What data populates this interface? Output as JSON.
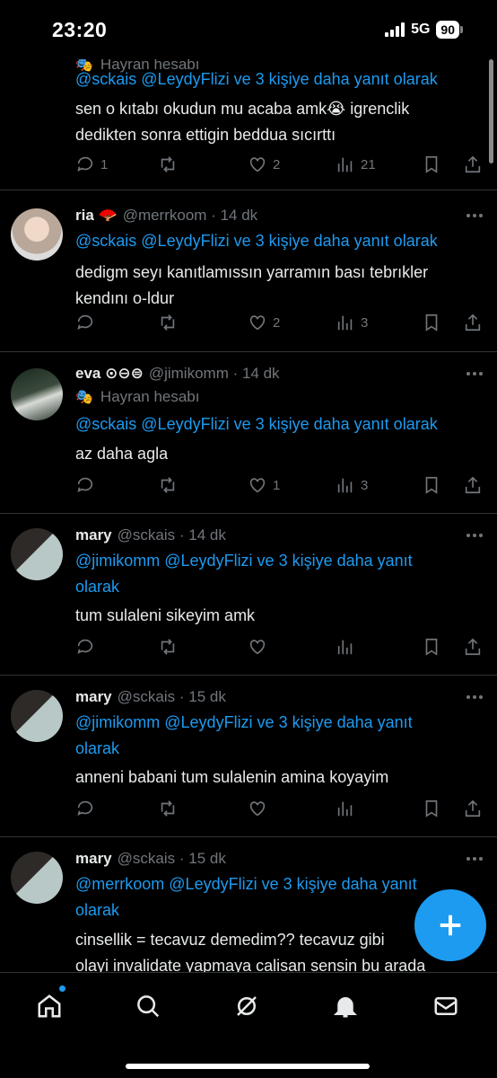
{
  "status": {
    "time": "23:20",
    "network": "5G",
    "battery": "90"
  },
  "posts": [
    {
      "label": "Hayran hesabı",
      "reply_to": "@sckais @LeydyFlizi ve 3 kişiye daha yanıt olarak",
      "text_lines": [
        "sen o kıtabı okudun mu acaba amk😭 igrenclik",
        "dedikten sonra ettigin beddua sıcırttı"
      ],
      "replies": "1",
      "retweets": "",
      "likes": "2",
      "views": "21"
    },
    {
      "author": "ria 🪭",
      "handle": "@merrkoom",
      "time": "14 dk",
      "reply_to": "@sckais @LeydyFlizi ve 3 kişiye daha yanıt olarak",
      "text_lines": [
        "dedigm seyı kanıtlamıssın yarramın bası tebrıkler",
        "kendını o-ldur"
      ],
      "replies": "",
      "retweets": "",
      "likes": "2",
      "views": "3"
    },
    {
      "author": "eva ⊙⊖⊜",
      "handle": "@jimikomm",
      "time": "14 dk",
      "label": "Hayran hesabı",
      "reply_to": "@sckais @LeydyFlizi ve 3 kişiye daha yanıt olarak",
      "text_lines": [
        "az daha agla"
      ],
      "replies": "",
      "retweets": "",
      "likes": "1",
      "views": "3"
    },
    {
      "author": "mary",
      "handle": "@sckais",
      "time": "14 dk",
      "reply_lines": [
        "@jimikomm @LeydyFlizi ve 3 kişiye daha yanıt",
        "olarak"
      ],
      "text_lines": [
        "tum sulaleni sikeyim amk"
      ],
      "replies": "",
      "retweets": "",
      "likes": "",
      "views": ""
    },
    {
      "author": "mary",
      "handle": "@sckais",
      "time": "15 dk",
      "reply_lines": [
        "@jimikomm @LeydyFlizi ve 3 kişiye daha yanıt",
        "olarak"
      ],
      "text_lines": [
        "anneni babani tum sulalenin amina koyayim"
      ],
      "replies": "",
      "retweets": "",
      "likes": "",
      "views": ""
    },
    {
      "author": "mary",
      "handle": "@sckais",
      "time": "15 dk",
      "reply_lines": [
        "@merrkoom @LeydyFlizi ve 3 kişiye daha yanıt",
        "olarak"
      ],
      "text_lines": [
        "cinsellik = tecavuz demedim?? tecavuz gibi",
        "olayi invalidate yapmaya calisan sensin bu arada"
      ]
    }
  ],
  "colors": {
    "accent": "#1d9bf0",
    "muted": "#71767b",
    "text": "#e7e9ea",
    "divider": "#2f3336"
  },
  "nav": [
    "home-icon",
    "search-icon",
    "grok-icon",
    "notifications-icon",
    "messages-icon"
  ]
}
